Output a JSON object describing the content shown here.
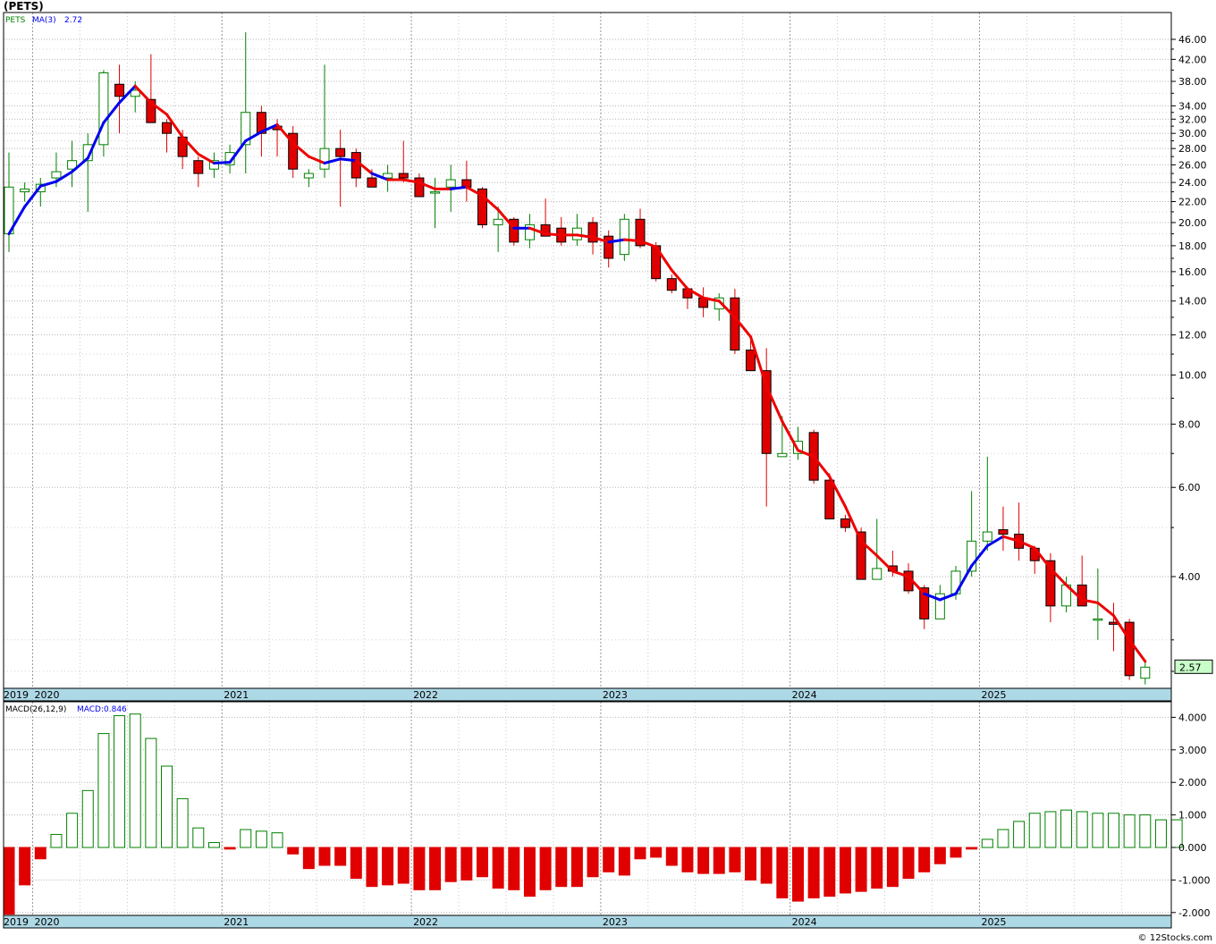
{
  "title": "(PETS)",
  "credit": "© 12Stocks.com",
  "colors": {
    "up": "#008000",
    "down": "#e00000",
    "ma_up": "#0000ee",
    "ma_down": "#ee0000",
    "axis_band": "#add8e6",
    "last_label_bg": "#c8ffc8"
  },
  "chart_data": [
    {
      "type": "candlestick",
      "scale": "log",
      "legend_ticker": "PETS",
      "legend_ma": "MA(3)",
      "legend_ma_value": "2.72",
      "last_price_label": "2.57",
      "y_ticks": [
        "46.00",
        "42.00",
        "38.00",
        "34.00",
        "32.00",
        "30.00",
        "28.00",
        "26.00",
        "24.00",
        "22.00",
        "20.00",
        "18.00",
        "16.00",
        "14.00",
        "12.00",
        "10.00",
        "8.00",
        "6.00",
        "4.00"
      ],
      "x_labels": [
        "2019",
        "2020",
        "2021",
        "2022",
        "2023",
        "2024",
        "2025"
      ],
      "x_label_months": [
        0.7,
        2,
        14,
        26,
        38,
        50,
        62
      ],
      "months": [
        "2019-11",
        "2019-12",
        "2020-01",
        "2020-02",
        "2020-03",
        "2020-04",
        "2020-05",
        "2020-06",
        "2020-07",
        "2020-08",
        "2020-09",
        "2020-10",
        "2020-11",
        "2020-12",
        "2021-01",
        "2021-02",
        "2021-03",
        "2021-04",
        "2021-05",
        "2021-06",
        "2021-07",
        "2021-08",
        "2021-09",
        "2021-10",
        "2021-11",
        "2021-12",
        "2022-01",
        "2022-02",
        "2022-03",
        "2022-04",
        "2022-05",
        "2022-06",
        "2022-07",
        "2022-08",
        "2022-09",
        "2022-10",
        "2022-11",
        "2022-12",
        "2023-01",
        "2023-02",
        "2023-03",
        "2023-04",
        "2023-05",
        "2023-06",
        "2023-07",
        "2023-08",
        "2023-09",
        "2023-10",
        "2023-11",
        "2023-12",
        "2024-01",
        "2024-02",
        "2024-03",
        "2024-04",
        "2024-05",
        "2024-06",
        "2024-07",
        "2024-08",
        "2024-09",
        "2024-10",
        "2024-11",
        "2024-12",
        "2025-01",
        "2025-02",
        "2025-03",
        "2025-04",
        "2025-05",
        "2025-06",
        "2025-07",
        "2025-08",
        "2025-09",
        "2025-10",
        "2025-11"
      ],
      "ohlc": [
        [
          19.0,
          27.5,
          17.5,
          23.5
        ],
        [
          23.0,
          24.0,
          22.0,
          23.3
        ],
        [
          23.0,
          24.5,
          21.5,
          23.8
        ],
        [
          24.5,
          27.5,
          23.5,
          25.2
        ],
        [
          25.5,
          29.0,
          23.5,
          26.5
        ],
        [
          26.5,
          30.0,
          21.0,
          28.5
        ],
        [
          28.5,
          40.0,
          27.0,
          39.5
        ],
        [
          37.5,
          41.0,
          30.0,
          35.5
        ],
        [
          35.5,
          38.0,
          33.0,
          36.5
        ],
        [
          35.0,
          43.0,
          31.5,
          31.5
        ],
        [
          31.5,
          32.0,
          27.5,
          30.0
        ],
        [
          29.5,
          30.5,
          25.5,
          27.0
        ],
        [
          26.5,
          27.0,
          23.5,
          25.0
        ],
        [
          25.5,
          27.5,
          24.5,
          26.5
        ],
        [
          26.0,
          28.5,
          25.0,
          27.5
        ],
        [
          28.5,
          47.5,
          25.0,
          33.0
        ],
        [
          33.0,
          34.0,
          27.0,
          30.0
        ],
        [
          31.0,
          32.0,
          27.0,
          30.5
        ],
        [
          30.0,
          31.0,
          24.5,
          25.5
        ],
        [
          24.5,
          25.5,
          23.5,
          25.0
        ],
        [
          25.5,
          41.0,
          24.5,
          28.0
        ],
        [
          28.0,
          30.5,
          21.5,
          27.0
        ],
        [
          27.5,
          28.0,
          23.5,
          24.5
        ],
        [
          24.5,
          25.5,
          23.5,
          23.5
        ],
        [
          24.5,
          26.0,
          23.0,
          25.0
        ],
        [
          25.0,
          29.0,
          24.0,
          24.5
        ],
        [
          24.5,
          25.0,
          22.5,
          22.5
        ],
        [
          23.0,
          24.5,
          19.5,
          23.0
        ],
        [
          23.5,
          26.0,
          21.0,
          24.3
        ],
        [
          24.3,
          26.5,
          22.0,
          23.5
        ],
        [
          23.3,
          23.5,
          19.5,
          19.8
        ],
        [
          19.8,
          21.5,
          17.5,
          20.3
        ],
        [
          20.3,
          20.5,
          18.0,
          18.3
        ],
        [
          18.5,
          20.8,
          17.8,
          19.8
        ],
        [
          19.8,
          22.3,
          19.0,
          18.8
        ],
        [
          19.5,
          20.5,
          18.0,
          18.3
        ],
        [
          18.5,
          20.8,
          18.0,
          19.5
        ],
        [
          20.0,
          20.5,
          17.3,
          18.3
        ],
        [
          18.8,
          19.3,
          16.3,
          17.0
        ],
        [
          17.3,
          20.8,
          16.8,
          20.3
        ],
        [
          20.3,
          21.3,
          17.8,
          18.0
        ],
        [
          18.0,
          18.3,
          15.3,
          15.5
        ],
        [
          15.5,
          15.8,
          14.5,
          14.7
        ],
        [
          14.8,
          14.8,
          13.5,
          14.2
        ],
        [
          14.2,
          14.9,
          13.0,
          13.6
        ],
        [
          13.5,
          14.5,
          12.8,
          14.2
        ],
        [
          14.2,
          14.8,
          11.0,
          11.2
        ],
        [
          11.2,
          11.7,
          10.2,
          10.2
        ],
        [
          10.2,
          11.3,
          5.5,
          7.0
        ],
        [
          6.9,
          8.3,
          6.9,
          7.0
        ],
        [
          7.0,
          7.9,
          6.8,
          7.4
        ],
        [
          7.7,
          7.8,
          6.1,
          6.2
        ],
        [
          6.2,
          6.4,
          5.2,
          5.2
        ],
        [
          5.2,
          5.3,
          4.9,
          5.0
        ],
        [
          4.9,
          5.0,
          3.95,
          3.95
        ],
        [
          3.95,
          5.2,
          3.95,
          4.15
        ],
        [
          4.2,
          4.5,
          4.0,
          4.1
        ],
        [
          4.1,
          4.25,
          3.7,
          3.75
        ],
        [
          3.8,
          3.85,
          3.15,
          3.3
        ],
        [
          3.3,
          3.85,
          3.3,
          3.7
        ],
        [
          3.7,
          4.2,
          3.6,
          4.1
        ],
        [
          4.1,
          5.9,
          4.0,
          4.7
        ],
        [
          4.7,
          6.9,
          4.5,
          4.9
        ],
        [
          4.95,
          5.5,
          4.5,
          4.85
        ],
        [
          4.85,
          5.6,
          4.3,
          4.55
        ],
        [
          4.55,
          4.6,
          4.05,
          4.3
        ],
        [
          4.3,
          4.45,
          3.25,
          3.5
        ],
        [
          3.5,
          4.0,
          3.4,
          3.85
        ],
        [
          3.85,
          4.4,
          3.55,
          3.5
        ],
        [
          3.3,
          4.15,
          3.0,
          3.3
        ],
        [
          3.25,
          3.55,
          2.85,
          3.22
        ],
        [
          3.25,
          3.3,
          2.5,
          2.55
        ],
        [
          2.52,
          2.72,
          2.45,
          2.65
        ]
      ],
      "ma3": [
        19.0,
        21.5,
        23.6,
        24.1,
        25.2,
        26.8,
        31.5,
        34.5,
        37.2,
        34.5,
        32.7,
        29.5,
        27.3,
        26.2,
        26.3,
        29.0,
        30.2,
        31.2,
        28.7,
        27.0,
        26.2,
        26.7,
        26.5,
        25.0,
        24.3,
        24.3,
        24.0,
        23.3,
        23.3,
        23.5,
        22.6,
        21.2,
        19.5,
        19.5,
        19.0,
        18.9,
        18.9,
        18.7,
        18.3,
        18.5,
        18.4,
        17.9,
        16.1,
        14.8,
        14.2,
        14.0,
        13.0,
        11.9,
        9.5,
        8.1,
        7.1,
        6.9,
        6.3,
        5.5,
        4.7,
        4.4,
        4.1,
        4.0,
        3.7,
        3.6,
        3.7,
        4.2,
        4.6,
        4.8,
        4.7,
        4.55,
        4.15,
        3.85,
        3.6,
        3.55,
        3.35,
        3.0,
        2.72
      ],
      "ma_up": [
        true,
        true,
        true,
        true,
        true,
        true,
        true,
        true,
        true,
        false,
        false,
        false,
        false,
        false,
        true,
        true,
        true,
        true,
        false,
        false,
        false,
        true,
        true,
        false,
        true,
        false,
        false,
        false,
        false,
        true,
        false,
        false,
        false,
        true,
        false,
        false,
        false,
        false,
        false,
        true,
        false,
        false,
        false,
        false,
        false,
        false,
        false,
        false,
        false,
        false,
        false,
        false,
        false,
        false,
        false,
        false,
        false,
        false,
        false,
        true,
        true,
        true,
        true,
        true,
        false,
        false,
        false,
        false,
        false,
        false,
        false,
        false,
        false
      ]
    },
    {
      "type": "bar",
      "legend_name": "MACD(26,12,9)",
      "legend_value": "MACD:0.846",
      "y_ticks": [
        "4.000",
        "3.000",
        "2.000",
        "1.000",
        "0.000",
        "-1.000",
        "-2.000"
      ],
      "ylim": [
        -2.1,
        4.3
      ],
      "values": [
        -2.05,
        -1.15,
        -0.35,
        0.4,
        1.05,
        1.75,
        3.5,
        4.05,
        4.1,
        3.35,
        2.5,
        1.5,
        0.6,
        0.15,
        -0.05,
        0.55,
        0.5,
        0.45,
        -0.2,
        -0.65,
        -0.55,
        -0.55,
        -0.95,
        -1.2,
        -1.15,
        -1.1,
        -1.3,
        -1.3,
        -1.05,
        -1.0,
        -0.9,
        -1.25,
        -1.3,
        -1.5,
        -1.3,
        -1.2,
        -1.2,
        -0.9,
        -0.75,
        -0.85,
        -0.35,
        -0.3,
        -0.55,
        -0.75,
        -0.8,
        -0.8,
        -0.75,
        -1.0,
        -1.1,
        -1.55,
        -1.65,
        -1.55,
        -1.5,
        -1.4,
        -1.35,
        -1.25,
        -1.2,
        -0.95,
        -0.75,
        -0.5,
        -0.3,
        -0.05,
        0.25,
        0.55,
        0.8,
        1.05,
        1.1,
        1.15,
        1.1,
        1.05,
        1.05,
        1.0,
        1.0,
        0.85,
        0.85
      ]
    }
  ]
}
